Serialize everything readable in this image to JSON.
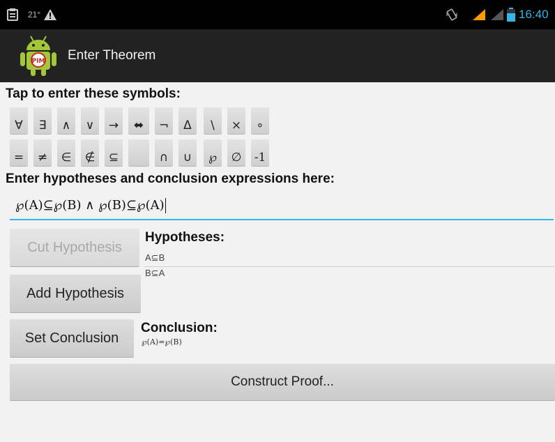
{
  "status_bar": {
    "temperature": "21°",
    "time": "16:40"
  },
  "action_bar": {
    "title": "Enter Theorem"
  },
  "symbols_instruction": "Tap to enter these symbols:",
  "symbols_row1": [
    "∀",
    "∃",
    "∧",
    "∨",
    "→",
    "⬌",
    "¬",
    "Δ",
    "\\",
    "×",
    "∘"
  ],
  "symbols_row2": [
    "=",
    "≠",
    "∈",
    "∉",
    "⊆",
    "",
    "∩",
    "∪",
    "℘",
    "∅",
    "-1"
  ],
  "expression_instruction": "Enter hypotheses and conclusion expressions here:",
  "expression_field": {
    "value": "℘(A)⊆℘(B) ∧ ℘(B)⊆℘(A)"
  },
  "buttons": {
    "cut_hypothesis": "Cut Hypothesis",
    "add_hypothesis": "Add Hypothesis",
    "set_conclusion": "Set Conclusion",
    "construct_proof": "Construct Proof..."
  },
  "hypotheses": {
    "heading": "Hypotheses:",
    "items": [
      "A⊆B",
      "B⊆A"
    ]
  },
  "conclusion": {
    "heading": "Conclusion:",
    "value": "℘(A)=℘(B)"
  },
  "colors": {
    "accent": "#33b5e5",
    "action_bar": "#222222",
    "background": "#f2f2f2"
  }
}
